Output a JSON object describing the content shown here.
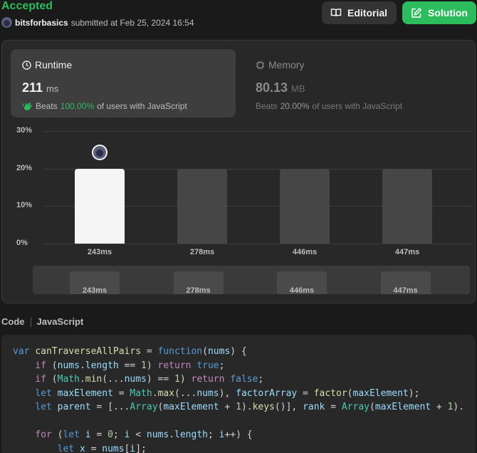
{
  "header": {
    "status": "Accepted",
    "username": "bitsforbasics",
    "submitted_text": "submitted at Feb 25, 2024 16:54",
    "editorial_label": "Editorial",
    "solution_label": "Solution"
  },
  "runtime": {
    "title": "Runtime",
    "value": "211",
    "unit": "ms",
    "beats_label": "Beats",
    "beats_pct": "100.00%",
    "beats_suffix": "of users with JavaScript"
  },
  "memory": {
    "title": "Memory",
    "value": "80.13",
    "unit": "MB",
    "beats_label": "Beats",
    "beats_pct": "20.00%",
    "beats_suffix": "of users with JavaScript"
  },
  "chart_data": {
    "type": "bar",
    "categories": [
      "243ms",
      "278ms",
      "446ms",
      "447ms"
    ],
    "values": [
      20,
      20,
      20,
      20
    ],
    "yticks": [
      "30%",
      "20%",
      "10%",
      "0%"
    ],
    "ylim": [
      0,
      30
    ],
    "grid": true,
    "highlighted_index": 0,
    "highlight_color": "#f5f5f5",
    "bar_color": "#464646"
  },
  "mini_chart": {
    "labels": [
      "243ms",
      "278ms",
      "446ms",
      "447ms"
    ]
  },
  "code": {
    "label": "Code",
    "language": "JavaScript",
    "lines": [
      [
        [
          "var ",
          "#569cd6"
        ],
        [
          "canTraverseAllPairs",
          "#dcdcaa"
        ],
        [
          " = ",
          "#d4d4d4"
        ],
        [
          "function",
          "#569cd6"
        ],
        [
          "(",
          "#d4d4d4"
        ],
        [
          "nums",
          "#9cdcfe"
        ],
        [
          ") {",
          "#d4d4d4"
        ]
      ],
      [
        [
          "    ",
          "#d4d4d4"
        ],
        [
          "if",
          "#c586c0"
        ],
        [
          " (",
          "#d4d4d4"
        ],
        [
          "nums",
          "#9cdcfe"
        ],
        [
          ".",
          "#d4d4d4"
        ],
        [
          "length",
          "#9cdcfe"
        ],
        [
          " == ",
          "#d4d4d4"
        ],
        [
          "1",
          "#b5cea8"
        ],
        [
          ") ",
          "#d4d4d4"
        ],
        [
          "return",
          "#c586c0"
        ],
        [
          " ",
          "#d4d4d4"
        ],
        [
          "true",
          "#569cd6"
        ],
        [
          ";",
          "#d4d4d4"
        ]
      ],
      [
        [
          "    ",
          "#d4d4d4"
        ],
        [
          "if",
          "#c586c0"
        ],
        [
          " (",
          "#d4d4d4"
        ],
        [
          "Math",
          "#4ec9b0"
        ],
        [
          ".",
          "#d4d4d4"
        ],
        [
          "min",
          "#dcdcaa"
        ],
        [
          "(...",
          "#d4d4d4"
        ],
        [
          "nums",
          "#9cdcfe"
        ],
        [
          ") == ",
          "#d4d4d4"
        ],
        [
          "1",
          "#b5cea8"
        ],
        [
          ") ",
          "#d4d4d4"
        ],
        [
          "return",
          "#c586c0"
        ],
        [
          " ",
          "#d4d4d4"
        ],
        [
          "false",
          "#569cd6"
        ],
        [
          ";",
          "#d4d4d4"
        ]
      ],
      [
        [
          "    ",
          "#d4d4d4"
        ],
        [
          "let",
          "#569cd6"
        ],
        [
          " ",
          "#d4d4d4"
        ],
        [
          "maxElement",
          "#9cdcfe"
        ],
        [
          " = ",
          "#d4d4d4"
        ],
        [
          "Math",
          "#4ec9b0"
        ],
        [
          ".",
          "#d4d4d4"
        ],
        [
          "max",
          "#dcdcaa"
        ],
        [
          "(...",
          "#d4d4d4"
        ],
        [
          "nums",
          "#9cdcfe"
        ],
        [
          "), ",
          "#d4d4d4"
        ],
        [
          "factorArray",
          "#9cdcfe"
        ],
        [
          " = ",
          "#d4d4d4"
        ],
        [
          "factor",
          "#dcdcaa"
        ],
        [
          "(",
          "#d4d4d4"
        ],
        [
          "maxElement",
          "#9cdcfe"
        ],
        [
          ");",
          "#d4d4d4"
        ]
      ],
      [
        [
          "    ",
          "#d4d4d4"
        ],
        [
          "let",
          "#569cd6"
        ],
        [
          " ",
          "#d4d4d4"
        ],
        [
          "parent",
          "#9cdcfe"
        ],
        [
          " = [...",
          "#d4d4d4"
        ],
        [
          "Array",
          "#4ec9b0"
        ],
        [
          "(",
          "#d4d4d4"
        ],
        [
          "maxElement",
          "#9cdcfe"
        ],
        [
          " + ",
          "#d4d4d4"
        ],
        [
          "1",
          "#b5cea8"
        ],
        [
          ").",
          "#d4d4d4"
        ],
        [
          "keys",
          "#dcdcaa"
        ],
        [
          "()], ",
          "#d4d4d4"
        ],
        [
          "rank",
          "#9cdcfe"
        ],
        [
          " = ",
          "#d4d4d4"
        ],
        [
          "Array",
          "#4ec9b0"
        ],
        [
          "(",
          "#d4d4d4"
        ],
        [
          "maxElement",
          "#9cdcfe"
        ],
        [
          " + ",
          "#d4d4d4"
        ],
        [
          "1",
          "#b5cea8"
        ],
        [
          ").",
          "#d4d4d4"
        ]
      ],
      [
        [
          "",
          "#d4d4d4"
        ]
      ],
      [
        [
          "    ",
          "#d4d4d4"
        ],
        [
          "for",
          "#c586c0"
        ],
        [
          " (",
          "#d4d4d4"
        ],
        [
          "let",
          "#569cd6"
        ],
        [
          " ",
          "#d4d4d4"
        ],
        [
          "i",
          "#9cdcfe"
        ],
        [
          " = ",
          "#d4d4d4"
        ],
        [
          "0",
          "#b5cea8"
        ],
        [
          "; ",
          "#d4d4d4"
        ],
        [
          "i",
          "#9cdcfe"
        ],
        [
          " < ",
          "#d4d4d4"
        ],
        [
          "nums",
          "#9cdcfe"
        ],
        [
          ".",
          "#d4d4d4"
        ],
        [
          "length",
          "#9cdcfe"
        ],
        [
          "; ",
          "#d4d4d4"
        ],
        [
          "i",
          "#9cdcfe"
        ],
        [
          "++) {",
          "#d4d4d4"
        ]
      ],
      [
        [
          "        ",
          "#d4d4d4"
        ],
        [
          "let",
          "#569cd6"
        ],
        [
          " ",
          "#d4d4d4"
        ],
        [
          "x",
          "#9cdcfe"
        ],
        [
          " = ",
          "#d4d4d4"
        ],
        [
          "nums",
          "#9cdcfe"
        ],
        [
          "[",
          "#d4d4d4"
        ],
        [
          "i",
          "#9cdcfe"
        ],
        [
          "];",
          "#d4d4d4"
        ]
      ]
    ]
  }
}
